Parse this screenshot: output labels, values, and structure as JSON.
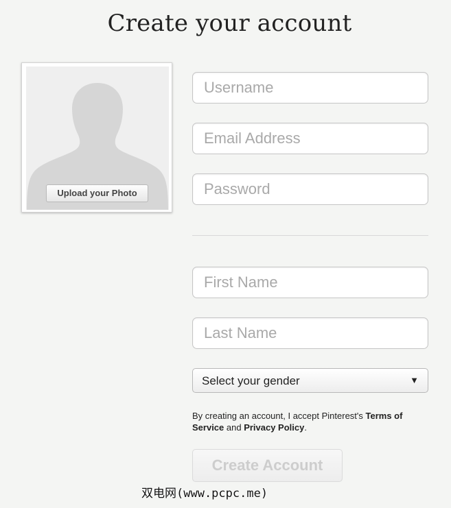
{
  "page": {
    "title": "Create your account"
  },
  "photo": {
    "placeholder_icon": "person-silhouette-icon",
    "upload_label": "Upload your Photo"
  },
  "form": {
    "username_placeholder": "Username",
    "email_placeholder": "Email Address",
    "password_placeholder": "Password",
    "first_name_placeholder": "First Name",
    "last_name_placeholder": "Last Name",
    "gender": {
      "selected": "Select your gender",
      "arrow_icon": "triangle-down-icon",
      "arrow_glyph": "▼"
    }
  },
  "terms": {
    "prefix": "By creating an account, I accept Pinterest's ",
    "terms_link": "Terms of Service",
    "middle": " and ",
    "privacy_link": "Privacy Policy",
    "suffix": "."
  },
  "submit": {
    "label": "Create Account",
    "state": "disabled"
  },
  "watermark": {
    "text": "双电网(www.pcpc.me)"
  },
  "colors": {
    "background": "#f4f5f3",
    "placeholder_text": "#a9a9a9",
    "disabled_button_text": "#cdcdcd",
    "silhouette": "#d6d6d6"
  }
}
